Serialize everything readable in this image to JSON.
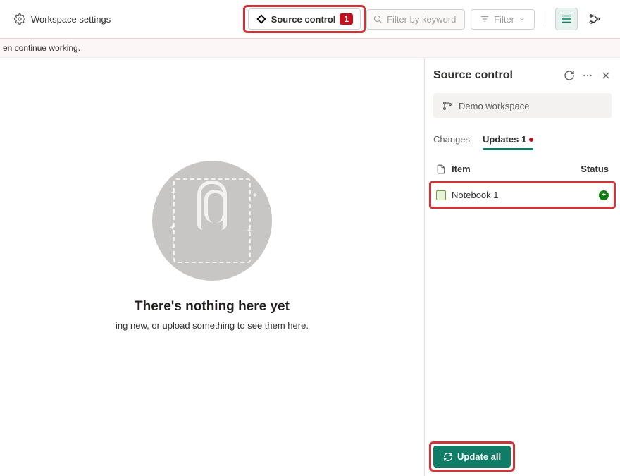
{
  "toolbar": {
    "settings_label": "Workspace settings",
    "source_control_label": "Source control",
    "source_control_badge": "1",
    "filter_placeholder": "Filter by keyword",
    "filter_button_label": "Filter"
  },
  "notice": {
    "text": "en continue working."
  },
  "empty_state": {
    "title": "There's nothing here yet",
    "subtitle": "ing new, or upload something to see them here."
  },
  "panel": {
    "title": "Source control",
    "workspace_name": "Demo workspace",
    "tabs": {
      "changes_label": "Changes",
      "updates_label": "Updates 1"
    },
    "columns": {
      "item_label": "Item",
      "status_label": "Status"
    },
    "items": [
      {
        "name": "Notebook 1"
      }
    ],
    "update_all_label": "Update all"
  }
}
